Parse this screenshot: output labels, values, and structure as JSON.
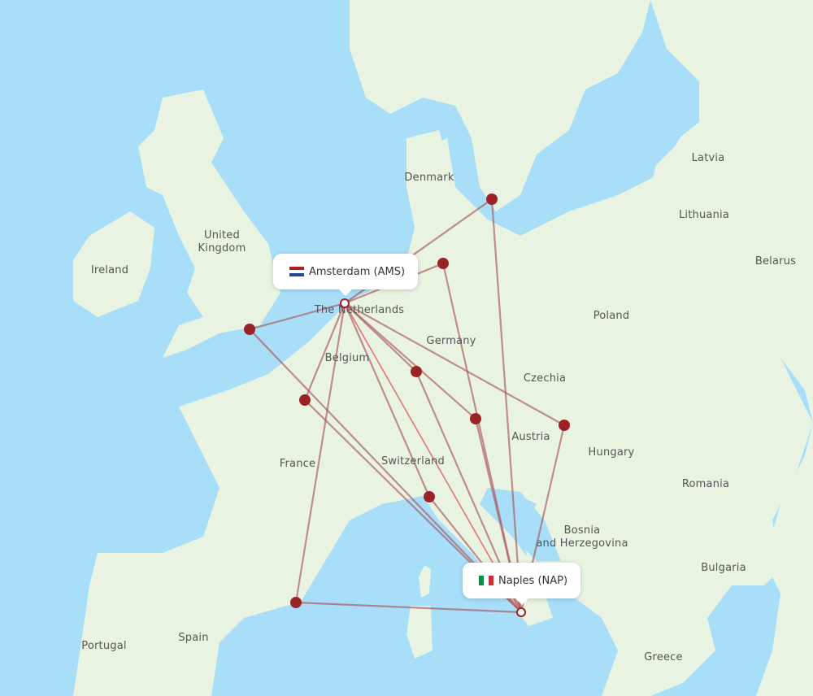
{
  "map": {
    "colors": {
      "water": "#a8def8",
      "land": "#e9f3e1",
      "border": "#8fcf86",
      "route": "#a8555a",
      "route_highlight": "#e8636a",
      "marker": "#9b2226"
    },
    "origin": {
      "name": "Amsterdam (AMS)",
      "flag": "netherlands-flag"
    },
    "destination": {
      "name": "Naples (NAP)",
      "flag": "italy-flag"
    },
    "country_labels": [
      {
        "id": "ireland",
        "text": "Ireland"
      },
      {
        "id": "uk",
        "text": "United Kingdom"
      },
      {
        "id": "netherlands",
        "text": "The Netherlands"
      },
      {
        "id": "belgium",
        "text": "Belgium"
      },
      {
        "id": "germany",
        "text": "Germany"
      },
      {
        "id": "denmark",
        "text": "Denmark"
      },
      {
        "id": "poland",
        "text": "Poland"
      },
      {
        "id": "czechia",
        "text": "Czechia"
      },
      {
        "id": "austria",
        "text": "Austria"
      },
      {
        "id": "hungary",
        "text": "Hungary"
      },
      {
        "id": "switzerland",
        "text": "Switzerland"
      },
      {
        "id": "france",
        "text": "France"
      },
      {
        "id": "spain",
        "text": "Spain"
      },
      {
        "id": "portugal",
        "text": "Portugal"
      },
      {
        "id": "romania",
        "text": "Romania"
      },
      {
        "id": "bosnia",
        "text": "Bosnia and Herzegovina"
      },
      {
        "id": "bulgaria",
        "text": "Bulgaria"
      },
      {
        "id": "greece",
        "text": "Greece"
      },
      {
        "id": "latvia",
        "text": "Latvia"
      },
      {
        "id": "lithuania",
        "text": "Lithuania"
      },
      {
        "id": "belarus",
        "text": "Belarus"
      }
    ],
    "stopover_airports": [
      {
        "id": "copenhagen-malmo"
      },
      {
        "id": "hamburg"
      },
      {
        "id": "bristol"
      },
      {
        "id": "frankfurt"
      },
      {
        "id": "munich"
      },
      {
        "id": "vienna-bratislava"
      },
      {
        "id": "paris"
      },
      {
        "id": "milan"
      },
      {
        "id": "barcelona"
      }
    ]
  }
}
